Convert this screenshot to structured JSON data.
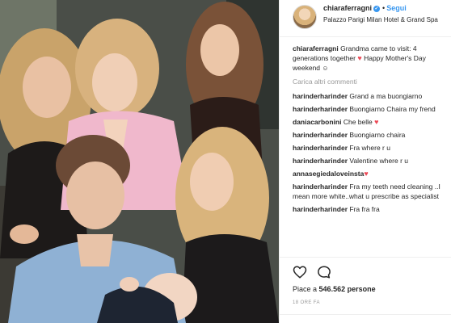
{
  "post": {
    "username": "chiaraferragni",
    "separator": "•",
    "follow_label": "Segui",
    "location": "Palazzo Parigi Milan Hotel & Grand Spa"
  },
  "caption": {
    "username": "chiaraferragni",
    "text_part1": "Grandma came to visit: 4 generations together",
    "text_part2": "Happy Mother's Day weekend"
  },
  "load_more_label": "Carica altri commenti",
  "comments": [
    {
      "user": "harinderharinder",
      "text": "Grand a ma buongiarno"
    },
    {
      "user": "harinderharinder",
      "text": "Buongiarno Chaira my frend"
    },
    {
      "user": "daniacarbonini",
      "text": "Che belle"
    },
    {
      "user": "harinderharinder",
      "text": "Buongiarno chaira"
    },
    {
      "user": "harinderharinder",
      "text": "Fra where r u"
    },
    {
      "user": "harinderharinder",
      "text": "Valentine where r u"
    },
    {
      "user": "annasegiedaloveinsta",
      "text": ""
    },
    {
      "user": "harinderharinder",
      "text": "Fra my teeth need cleaning ..I mean more white..what u prescribe as specialist"
    },
    {
      "user": "harinderharinder",
      "text": "Fra fra fra"
    }
  ],
  "likes": {
    "prefix": "Piace a",
    "count": "546.562",
    "suffix": "persone"
  },
  "timestamp": "18 ORE FA",
  "icons": {
    "like": "heart-outline-icon",
    "comment": "speech-bubble-icon",
    "verified": "verified-badge-icon"
  },
  "colors": {
    "link": "#3897f0",
    "heart": "#ed4956",
    "muted": "#999999"
  }
}
